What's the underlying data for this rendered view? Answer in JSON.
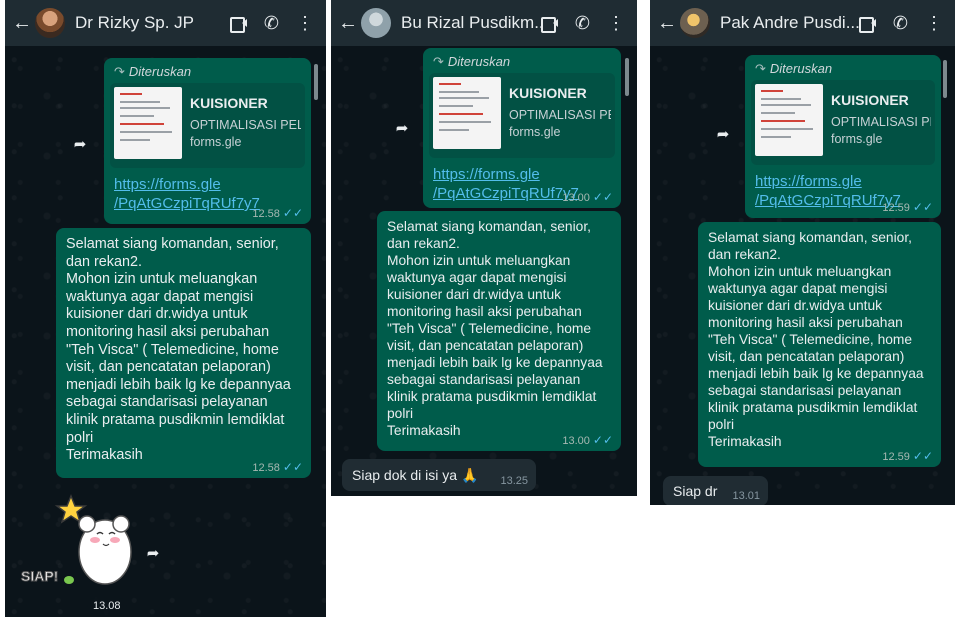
{
  "chats": [
    {
      "contact_name": "Dr Rizky Sp. JP",
      "forwarded_label": "Diteruskan",
      "preview_title": "KUISIONER",
      "preview_subtitle": "OPTIMALISASI PEL...",
      "preview_domain": "forms.gle",
      "link_line1": "https://forms.gle",
      "link_line2": "/PqAtGCzpiTqRUf7y7",
      "link_time": "12.58",
      "message_text": "Selamat siang komandan, senior,\ndan rekan2.\nMohon izin untuk meluangkan\nwaktunya agar dapat mengisi\nkuisioner dari dr.widya untuk\nmonitoring hasil aksi perubahan\n\"Teh Visca\" ( Telemedicine, home\nvisit, dan pencatatan pelaporan)\nmenjadi lebih baik lg ke depannyaa\nsebagai standarisasi pelayanan\nklinik pratama pusdikmin lemdiklat\npolri\nTerimakasih",
      "message_time": "12.58",
      "sticker_text": "SIAP!",
      "sticker_time": "13.08"
    },
    {
      "contact_name": "Bu Rizal Pusdikm...",
      "forwarded_label": "Diteruskan",
      "preview_title": "KUISIONER",
      "preview_subtitle": "OPTIMALISASI PEL...",
      "preview_domain": "forms.gle",
      "link_line1": "https://forms.gle",
      "link_line2": "/PqAtGCzpiTqRUf7y7",
      "link_time": "13.00",
      "message_text": "Selamat siang komandan, senior,\ndan rekan2.\nMohon izin untuk meluangkan\nwaktunya agar dapat mengisi\nkuisioner dari dr.widya untuk\nmonitoring hasil aksi perubahan\n\"Teh Visca\" ( Telemedicine, home\nvisit, dan pencatatan pelaporan)\nmenjadi lebih baik lg ke depannyaa\nsebagai standarisasi pelayanan\nklinik pratama pusdikmin lemdiklat\npolri\nTerimakasih",
      "message_time": "13.00",
      "reply_text": "Siap dok di isi ya 🙏",
      "reply_time": "13.25"
    },
    {
      "contact_name": "Pak Andre Pusdi...",
      "forwarded_label": "Diteruskan",
      "preview_title": "KUISIONER",
      "preview_subtitle": "OPTIMALISASI PEL...",
      "preview_domain": "forms.gle",
      "link_line1": "https://forms.gle",
      "link_line2": "/PqAtGCzpiTqRUf7y7",
      "link_time": "12.59",
      "message_text": "Selamat siang komandan, senior,\ndan rekan2.\nMohon izin untuk meluangkan\nwaktunya agar dapat mengisi\nkuisioner dari dr.widya untuk\nmonitoring hasil aksi perubahan\n\"Teh Visca\" ( Telemedicine, home\nvisit, dan pencatatan pelaporan)\nmenjadi lebih baik lg ke depannyaa\nsebagai standarisasi pelayanan\nklinik pratama pusdikmin lemdiklat\npolri\nTerimakasih",
      "message_time": "12.59",
      "reply_text": "Siap dr",
      "reply_time": "13.01"
    }
  ],
  "icons": {
    "back": "arrow-left-icon",
    "video": "video-call-icon",
    "call": "phone-icon",
    "menu": "more-vertical-icon",
    "forward": "forward-icon",
    "read": "double-check-icon"
  },
  "colors": {
    "chat_background": "#0b141a",
    "header": "#1f2c33",
    "outgoing_bubble": "#005c4b",
    "incoming_bubble": "#202c33",
    "link": "#53bdeb",
    "read_tick": "#53bdeb"
  }
}
